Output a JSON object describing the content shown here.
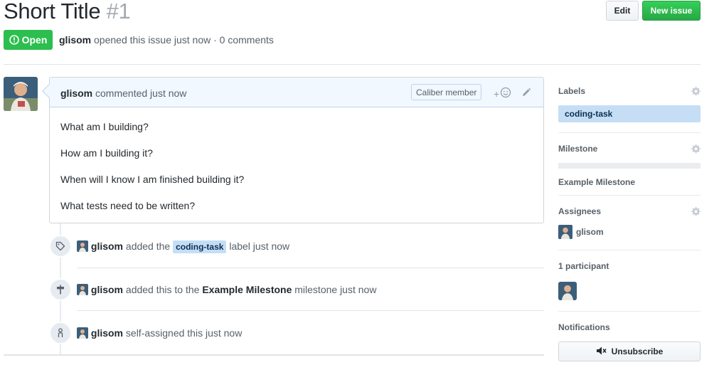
{
  "issue": {
    "title": "Short Title",
    "number": "#1",
    "state": "Open",
    "author": "glisom",
    "opened_text": "opened this issue just now · 0 comments"
  },
  "header_actions": {
    "edit_label": "Edit",
    "new_issue_label": "New issue"
  },
  "comment": {
    "author": "glisom",
    "action_text": "commented just now",
    "role_badge": "Caliber member",
    "reaction_plus": "+",
    "body": [
      "What am I building?",
      "How am I building it?",
      "When will I know I am finished building it?",
      "What tests need to be written?"
    ]
  },
  "timeline": [
    {
      "icon": "tag-icon",
      "actor": "glisom",
      "pre": "added the",
      "label": "coding-task",
      "post": "label just now"
    },
    {
      "icon": "milestone-icon",
      "actor": "glisom",
      "pre": "added this to the",
      "milestone": "Example Milestone",
      "post": "milestone just now"
    },
    {
      "icon": "person-icon",
      "actor": "glisom",
      "text": "self-assigned this just now"
    }
  ],
  "sidebar": {
    "labels": {
      "heading": "Labels",
      "items": [
        "coding-task"
      ]
    },
    "milestone": {
      "heading": "Milestone",
      "name": "Example Milestone",
      "progress": 0
    },
    "assignees": {
      "heading": "Assignees",
      "items": [
        "glisom"
      ]
    },
    "participants": {
      "heading": "1 participant"
    },
    "notifications": {
      "heading": "Notifications",
      "button": "Unsubscribe"
    }
  },
  "colors": {
    "open_green": "#2cbe4e",
    "label_bg": "#c5def5",
    "comment_header_bg": "#f1f8ff"
  }
}
